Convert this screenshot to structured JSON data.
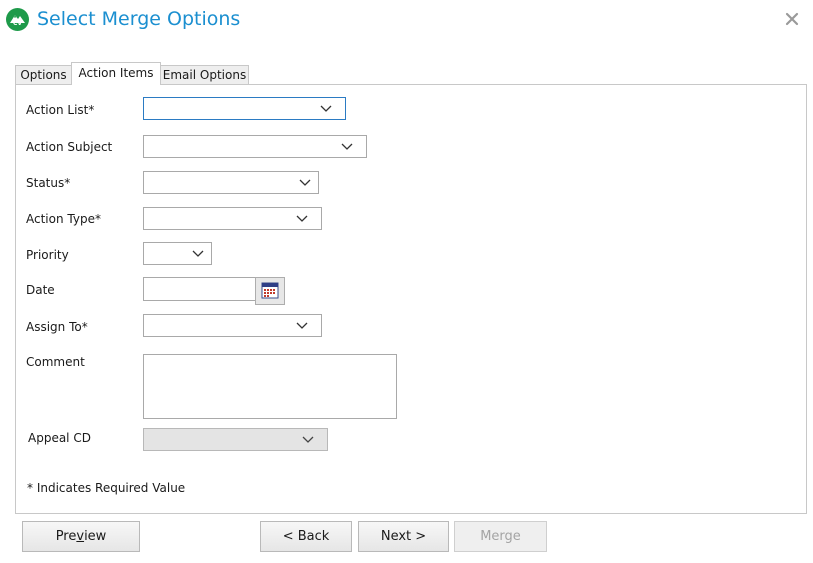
{
  "dialog": {
    "title": "Select Merge Options",
    "logo_text": "CV",
    "icons": {
      "logo": "app-logo-icon",
      "close": "close-icon"
    }
  },
  "tabs": [
    {
      "label": "Options",
      "active": false
    },
    {
      "label": "Action Items",
      "active": true
    },
    {
      "label": "Email Options",
      "active": false
    }
  ],
  "form": {
    "action_list": {
      "label": "Action List*",
      "value": ""
    },
    "action_subject": {
      "label": "Action Subject",
      "value": ""
    },
    "status": {
      "label": "Status*",
      "value": ""
    },
    "action_type": {
      "label": "Action Type*",
      "value": ""
    },
    "priority": {
      "label": "Priority",
      "value": ""
    },
    "date": {
      "label": "Date",
      "value": ""
    },
    "assign_to": {
      "label": "Assign To*",
      "value": ""
    },
    "comment": {
      "label": "Comment",
      "value": ""
    },
    "appeal_cd": {
      "label": "Appeal CD",
      "value": "",
      "disabled": true
    },
    "required_note": "* Indicates Required Value"
  },
  "buttons": {
    "preview": {
      "pre": "Pre",
      "mnemonic": "v",
      "post": "iew"
    },
    "back": "< Back",
    "next": "Next >",
    "merge": {
      "label": "Merge",
      "disabled": true
    }
  },
  "colors": {
    "title": "#1b8fd0",
    "logo": "#1e9a4a",
    "focus_border": "#2b7bc3"
  }
}
